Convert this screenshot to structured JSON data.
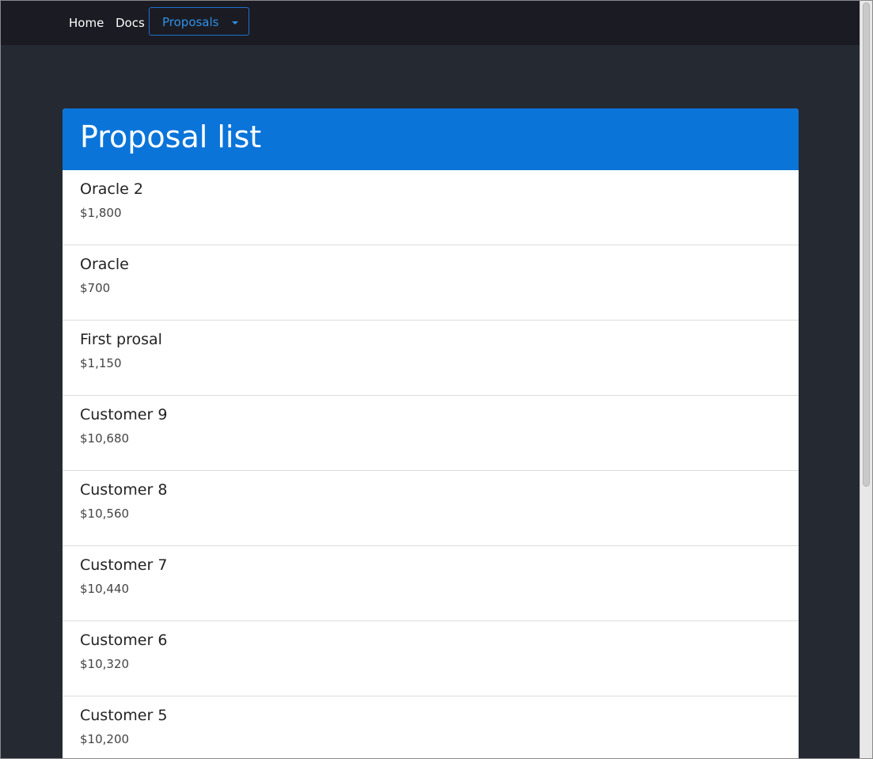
{
  "nav": {
    "home": "Home",
    "docs": "Docs",
    "proposals": "Proposals"
  },
  "page": {
    "title": "Proposal list"
  },
  "proposals": [
    {
      "name": "Oracle 2",
      "amount": "$1,800"
    },
    {
      "name": "Oracle",
      "amount": "$700"
    },
    {
      "name": "First prosal",
      "amount": "$1,150"
    },
    {
      "name": "Customer 9",
      "amount": "$10,680"
    },
    {
      "name": "Customer 8",
      "amount": "$10,560"
    },
    {
      "name": "Customer 7",
      "amount": "$10,440"
    },
    {
      "name": "Customer 6",
      "amount": "$10,320"
    },
    {
      "name": "Customer 5",
      "amount": "$10,200"
    }
  ],
  "colors": {
    "navbar": "#1b1c23",
    "background": "#252932",
    "header": "#0a74d9",
    "accent": "#2f8fe8"
  }
}
